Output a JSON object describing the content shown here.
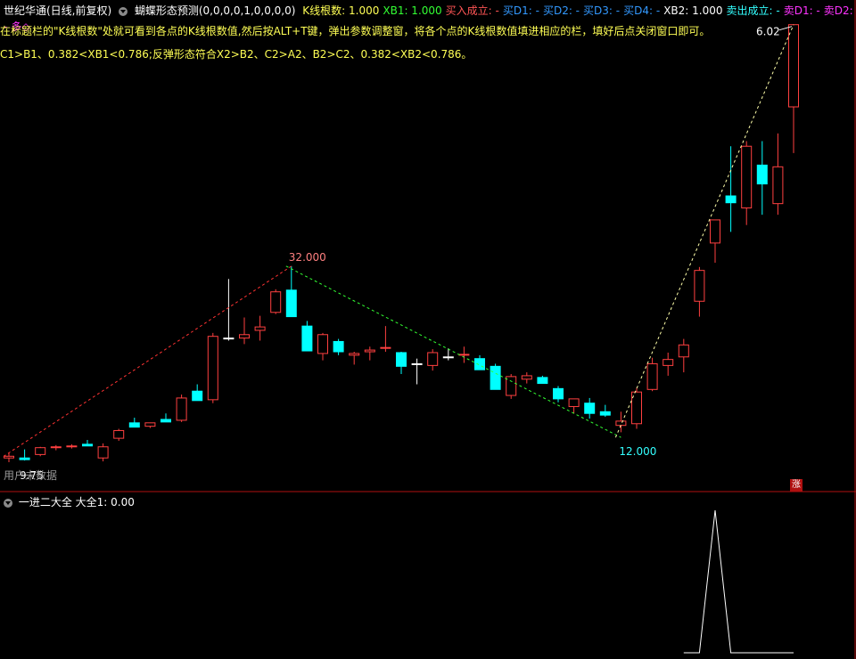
{
  "header": {
    "title": "世纪华通(日线,前复权)",
    "indicator_name": "蝴蝶形态预测(0,0,0,0,1,0,0,0,0)",
    "items": [
      {
        "text": "K线根数: 1.000",
        "color": "#ffff55"
      },
      {
        "text": "XB1: 1.000",
        "color": "#33ff33"
      },
      {
        "text": "买入成立: -",
        "color": "#ff5555"
      },
      {
        "text": "买D1: -",
        "color": "#3399ff"
      },
      {
        "text": "买D2: -",
        "color": "#3399ff"
      },
      {
        "text": "买D3: -",
        "color": "#3399ff"
      },
      {
        "text": "买D4: -",
        "color": "#3399ff"
      },
      {
        "text": "XB2: 1.000",
        "color": "#ffffff"
      },
      {
        "text": "卖出成立: -",
        "color": "#33ffff"
      },
      {
        "text": "卖D1: -",
        "color": "#ff33ff"
      },
      {
        "text": "卖D2: -",
        "color": "#ff33ff"
      },
      {
        "text": "多◇",
        "color": "#ff33ff"
      }
    ]
  },
  "notes": {
    "line1": "在标题栏的\"K线根数\"处就可看到各点的K线根数值,然后按ALT+T键，弹出参数调整窗，将各个点的K线根数值填进相应的栏，填好后点关闭窗口即可。",
    "line2": "C1>B1、0.382<XB1<0.786;反弹形态符合X2>B2、C2>A2、B2>C2、0.382<XB2<0.786。"
  },
  "price_labels": {
    "high": "32.000",
    "low": "12.000",
    "last": "6.02",
    "start": "9.75"
  },
  "overlay_text": "用户未数据",
  "badge": "涨",
  "sub_header": {
    "name": "一进二大全",
    "value": "大全1: 0.00"
  },
  "colors": {
    "up": "#ff4040",
    "down": "#00ffff",
    "doji": "#ffffff",
    "bg": "#000000",
    "separator": "#b01010",
    "pattern_up": "#ff3333",
    "pattern_down": "#33ff33",
    "pattern_rise": "#ffffaa"
  },
  "chart_data": {
    "type": "candlestick",
    "candles": [
      {
        "o": 9.6,
        "h": 10.2,
        "l": 9.1,
        "c": 9.8
      },
      {
        "o": 9.6,
        "h": 10.6,
        "l": 9.3,
        "c": 9.4
      },
      {
        "o": 10.0,
        "h": 10.9,
        "l": 9.8,
        "c": 10.8
      },
      {
        "o": 10.8,
        "h": 11.1,
        "l": 10.5,
        "c": 10.9
      },
      {
        "o": 10.9,
        "h": 11.2,
        "l": 10.7,
        "c": 11.0
      },
      {
        "o": 11.2,
        "h": 11.7,
        "l": 11.0,
        "c": 11.0
      },
      {
        "o": 9.6,
        "h": 11.3,
        "l": 9.2,
        "c": 10.9
      },
      {
        "o": 11.9,
        "h": 13.0,
        "l": 11.6,
        "c": 12.8
      },
      {
        "o": 13.7,
        "h": 14.3,
        "l": 13.4,
        "c": 13.2
      },
      {
        "o": 13.3,
        "h": 13.7,
        "l": 13.1,
        "c": 13.7
      },
      {
        "o": 14.1,
        "h": 14.8,
        "l": 13.9,
        "c": 13.8
      },
      {
        "o": 14.0,
        "h": 17.0,
        "l": 13.8,
        "c": 16.6
      },
      {
        "o": 17.4,
        "h": 18.2,
        "l": 16.3,
        "c": 16.3
      },
      {
        "o": 16.4,
        "h": 24.2,
        "l": 16.0,
        "c": 23.8
      },
      {
        "o": 23.6,
        "h": 30.5,
        "l": 23.3,
        "c": 23.6
      },
      {
        "o": 23.6,
        "h": 26.0,
        "l": 22.9,
        "c": 24.0
      },
      {
        "o": 24.5,
        "h": 26.2,
        "l": 23.3,
        "c": 24.9
      },
      {
        "o": 26.6,
        "h": 29.3,
        "l": 26.4,
        "c": 29.0
      },
      {
        "o": 29.2,
        "h": 32.0,
        "l": 26.9,
        "c": 26.1
      },
      {
        "o": 25.0,
        "h": 25.6,
        "l": 22.2,
        "c": 22.1
      },
      {
        "o": 21.8,
        "h": 24.2,
        "l": 21.0,
        "c": 24.0
      },
      {
        "o": 23.2,
        "h": 23.5,
        "l": 21.6,
        "c": 22.0
      },
      {
        "o": 21.6,
        "h": 22.0,
        "l": 20.5,
        "c": 21.8
      },
      {
        "o": 22.0,
        "h": 22.6,
        "l": 21.0,
        "c": 22.2
      },
      {
        "o": 22.4,
        "h": 25.0,
        "l": 22.0,
        "c": 22.5
      },
      {
        "o": 21.9,
        "h": 22.0,
        "l": 19.4,
        "c": 20.3
      },
      {
        "o": 20.6,
        "h": 21.2,
        "l": 18.2,
        "c": 20.6
      },
      {
        "o": 20.4,
        "h": 22.3,
        "l": 19.8,
        "c": 21.9
      },
      {
        "o": 21.4,
        "h": 22.4,
        "l": 21.0,
        "c": 21.4
      },
      {
        "o": 21.6,
        "h": 22.6,
        "l": 20.7,
        "c": 21.7
      },
      {
        "o": 21.2,
        "h": 21.6,
        "l": 19.9,
        "c": 19.9
      },
      {
        "o": 20.3,
        "h": 20.6,
        "l": 17.6,
        "c": 17.6
      },
      {
        "o": 16.9,
        "h": 19.4,
        "l": 16.5,
        "c": 19.1
      },
      {
        "o": 18.8,
        "h": 19.6,
        "l": 18.3,
        "c": 19.2
      },
      {
        "o": 19.0,
        "h": 19.2,
        "l": 18.4,
        "c": 18.3
      },
      {
        "o": 17.7,
        "h": 18.0,
        "l": 16.1,
        "c": 16.5
      },
      {
        "o": 15.6,
        "h": 16.2,
        "l": 14.8,
        "c": 16.5
      },
      {
        "o": 16.0,
        "h": 16.6,
        "l": 14.2,
        "c": 14.8
      },
      {
        "o": 15.0,
        "h": 15.8,
        "l": 14.4,
        "c": 14.6
      },
      {
        "o": 13.4,
        "h": 15.0,
        "l": 12.6,
        "c": 13.9
      },
      {
        "o": 13.6,
        "h": 17.8,
        "l": 13.0,
        "c": 17.3
      },
      {
        "o": 17.6,
        "h": 21.3,
        "l": 17.4,
        "c": 20.6
      },
      {
        "o": 20.4,
        "h": 21.9,
        "l": 19.2,
        "c": 21.1
      },
      {
        "o": 21.4,
        "h": 23.5,
        "l": 19.6,
        "c": 22.8
      },
      {
        "o": 27.9,
        "h": 31.9,
        "l": 26.1,
        "c": 31.5
      },
      {
        "o": 34.7,
        "h": 36.8,
        "l": 32.4,
        "c": 37.4
      },
      {
        "o": 40.2,
        "h": 46.0,
        "l": 36.0,
        "c": 39.4
      },
      {
        "o": 38.8,
        "h": 46.6,
        "l": 36.8,
        "c": 46.0
      },
      {
        "o": 43.8,
        "h": 46.6,
        "l": 38.0,
        "c": 41.6
      },
      {
        "o": 39.3,
        "h": 47.5,
        "l": 38.0,
        "c": 43.6
      },
      {
        "o": 50.6,
        "h": 60.2,
        "l": 45.2,
        "c": 60.2
      }
    ],
    "pattern_points": [
      {
        "index": 0,
        "value": 10.2
      },
      {
        "index": 18,
        "value": 32.0
      },
      {
        "index": 39,
        "value": 12.0
      },
      {
        "index": 50,
        "value": 60.2
      }
    ],
    "sub_indicator": {
      "name": "大全1",
      "values": [
        0,
        0,
        0,
        0,
        0,
        0,
        0,
        0,
        0,
        0,
        0,
        0,
        0,
        0,
        0,
        0,
        0,
        0,
        0,
        0,
        0,
        0,
        0,
        0,
        0,
        0,
        0,
        0,
        0,
        0,
        0,
        0,
        0,
        0,
        0,
        0,
        0,
        0,
        0,
        0,
        0,
        0,
        0,
        0,
        0,
        1,
        0,
        0,
        0,
        0,
        0
      ]
    }
  }
}
